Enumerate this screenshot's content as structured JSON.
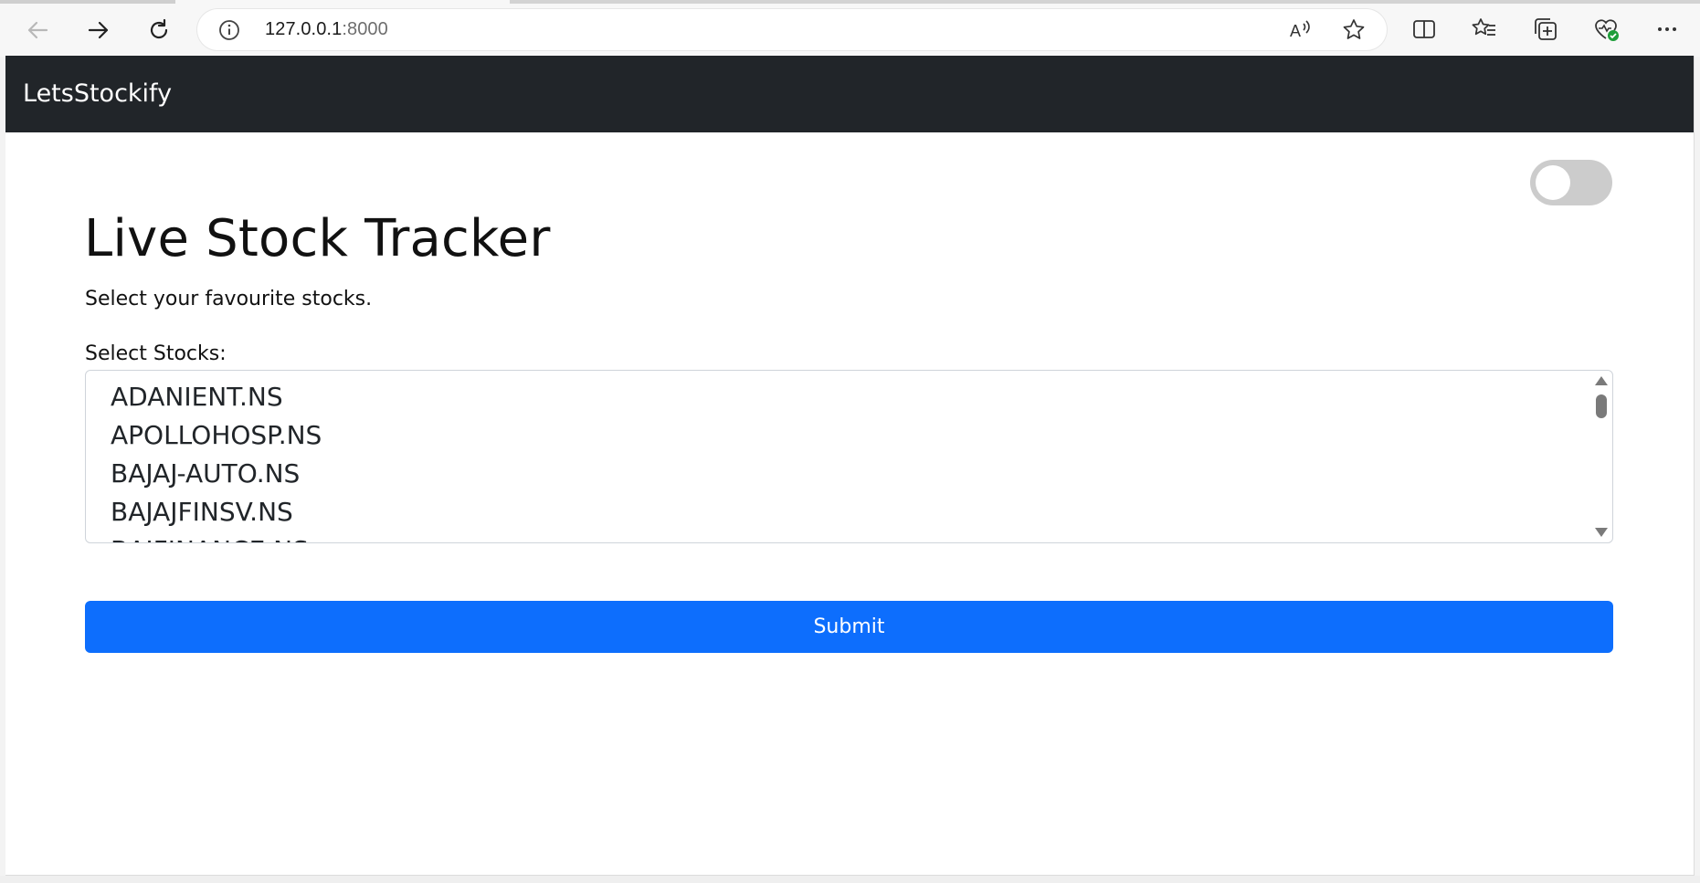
{
  "browser": {
    "url_host": "127.0.0.1",
    "url_port": ":8000",
    "icons": {
      "back": "back-arrow-icon",
      "forward": "forward-arrow-icon",
      "refresh": "refresh-icon",
      "info": "info-icon",
      "read_aloud": "read-aloud-icon",
      "favorite": "star-icon",
      "split_screen": "split-screen-icon",
      "favorites": "favorites-icon",
      "collections": "collections-icon",
      "health": "browser-essentials-icon",
      "more": "more-icon"
    }
  },
  "navbar": {
    "brand": "LetsStockify"
  },
  "theme_toggle": {
    "on": false
  },
  "main": {
    "title": "Live Stock Tracker",
    "subtitle": "Select your favourite stocks.",
    "select_label": "Select Stocks:",
    "stocks": [
      "ADANIENT.NS",
      "APOLLOHOSP.NS",
      "BAJAJ-AUTO.NS",
      "BAJAJFINSV.NS",
      "BAJFINANCE.NS"
    ],
    "submit_label": "Submit"
  },
  "colors": {
    "navbar_bg": "#212529",
    "primary": "#0d6efd",
    "toggle_off": "#cccccc"
  }
}
